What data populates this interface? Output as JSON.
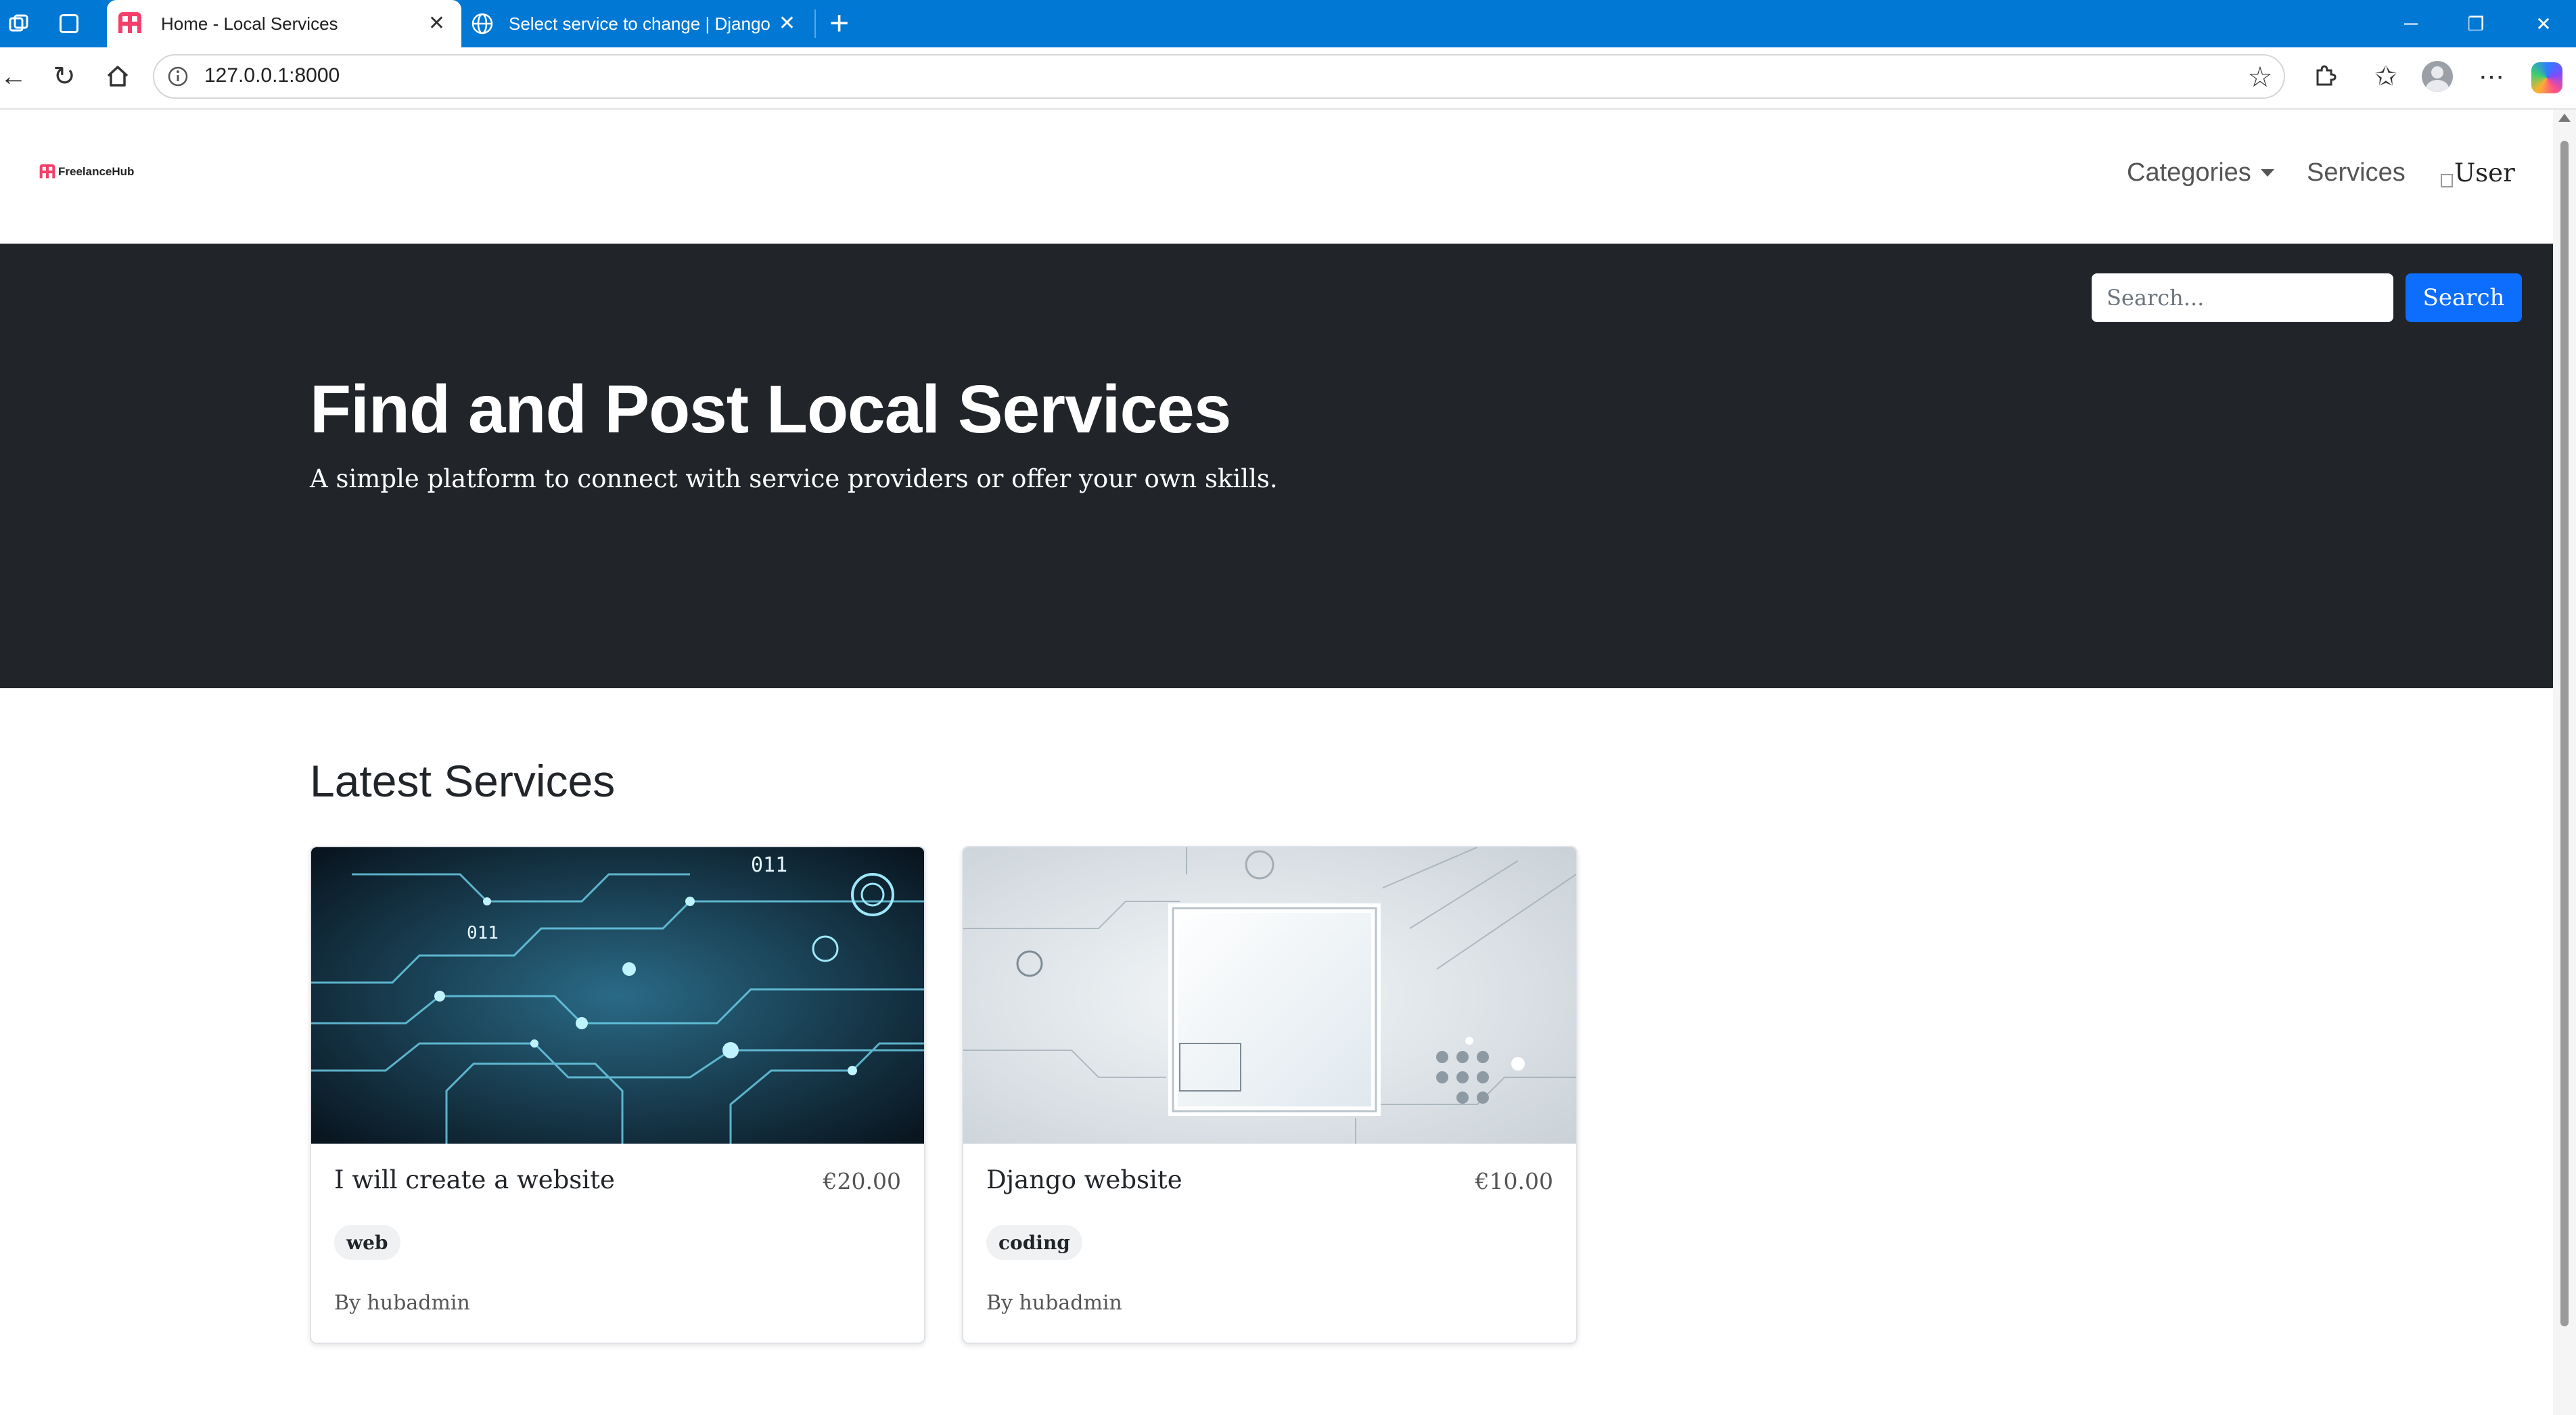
{
  "browser": {
    "tabs": [
      {
        "title": "Home - Local Services",
        "active": true
      },
      {
        "title": "Select service to change | Django"
      }
    ],
    "url": "127.0.0.1:8000",
    "accent_color": "#0078d4"
  },
  "navbar": {
    "brand": "FreelanceHub",
    "categories_label": "Categories",
    "services_label": "Services",
    "user_alt": "User"
  },
  "hero": {
    "title": "Find and Post Local Services",
    "subtitle": "A simple platform to connect with service providers or offer your own skills.",
    "search_placeholder": "Search...",
    "search_button": "Search",
    "background": "#212529",
    "button_color": "#0d6efd"
  },
  "latest": {
    "heading": "Latest Services",
    "cards": [
      {
        "title": "I will create a website",
        "price": "€20.00",
        "tag": "web",
        "author": "By hubadmin",
        "image_text_1": "011",
        "image_text_2": "011"
      },
      {
        "title": "Django website",
        "price": "€10.00",
        "tag": "coding",
        "author": "By hubadmin"
      }
    ]
  }
}
